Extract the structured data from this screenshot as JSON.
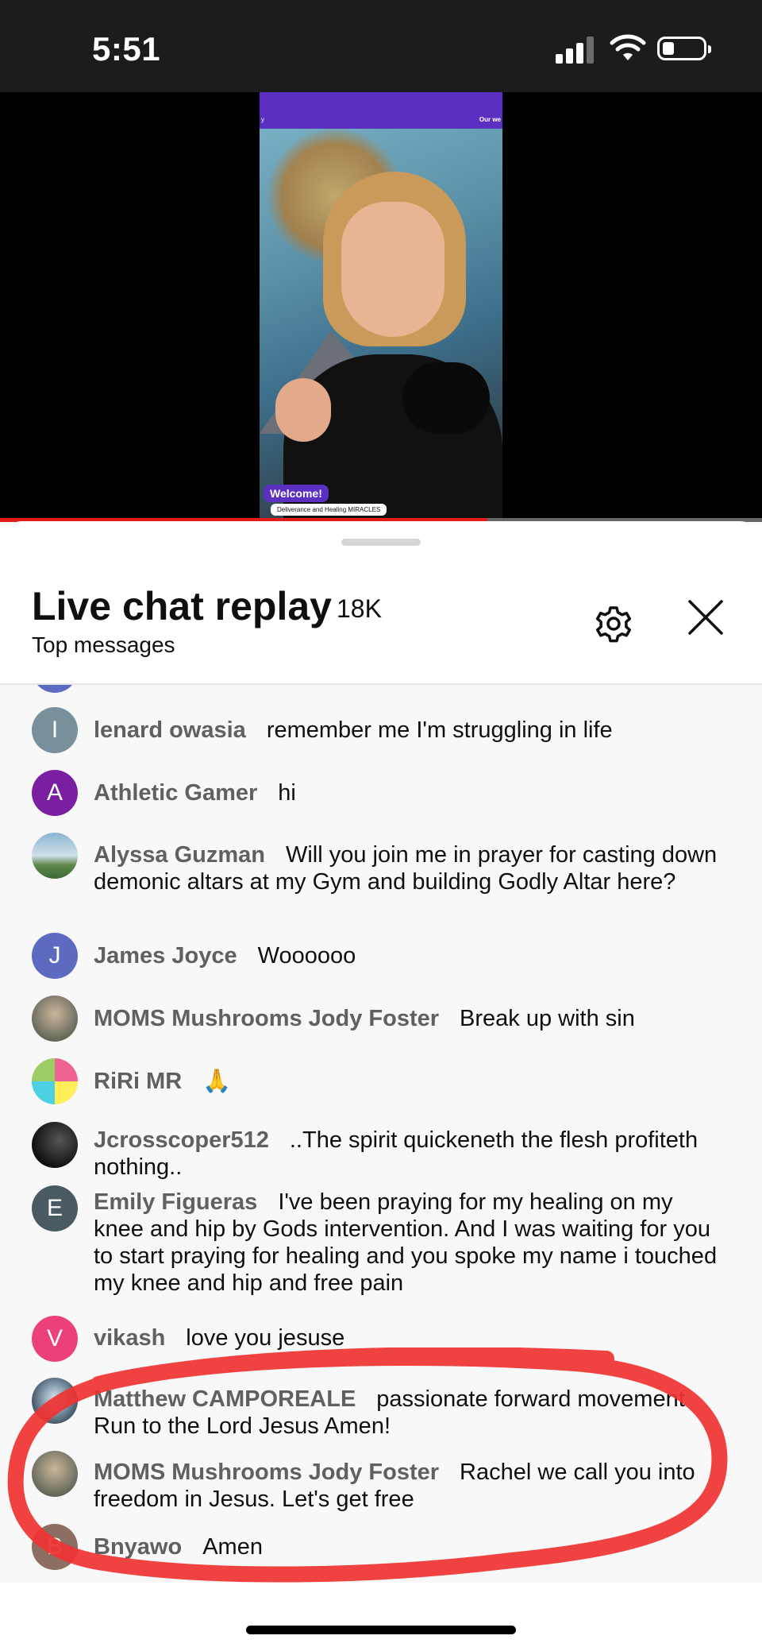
{
  "status_bar": {
    "time": "5:51"
  },
  "video": {
    "clip_top_left": "y",
    "clip_top_right": "Our we",
    "welcome": "Welcome!",
    "banner": "Deliverance and Healing MIRACLES",
    "progress_fraction": 0.64
  },
  "panel": {
    "title": "Live chat replay",
    "count": "18K",
    "subtitle": "Top messages"
  },
  "messages": [
    {
      "author": "lenard owasia",
      "text": "remember me I'm struggling in life",
      "initial": "I",
      "color": "#78909c"
    },
    {
      "author": "Athletic Gamer",
      "text": "hi",
      "initial": "A",
      "color": "#7b1fa2"
    },
    {
      "author": "Alyssa Guzman",
      "text": "Will you join me in prayer for casting down demonic altars at my Gym and building Godly Altar here?",
      "initial": "",
      "color": "#8bb3d1"
    },
    {
      "author": "James Joyce",
      "text": "Woooooo",
      "initial": "J",
      "color": "#5c6bc0"
    },
    {
      "author": "MOMS Mushrooms Jody Foster",
      "text": "Break up with sin",
      "initial": "",
      "color": "#8d8a7c"
    },
    {
      "author": "RiRi MR",
      "text": "🙏",
      "initial": "",
      "color": "#c0ca33"
    },
    {
      "author": "Jcrosscoper512",
      "text": "..The spirit quickeneth the flesh profiteth nothing..",
      "initial": "",
      "color": "#222222"
    },
    {
      "author": "Emily Figueras",
      "text": "I've been praying for my healing on my knee and hip by Gods intervention. And I was waiting for you to start praying for healing and you spoke my name i touched my knee and hip and free pain",
      "initial": "E",
      "color": "#4a5a63"
    },
    {
      "author": "vikash",
      "text": "love you jesuse",
      "initial": "V",
      "color": "#ec407a"
    },
    {
      "author": "Matthew CAMPOREALE",
      "text": "passionate forward movement Run to the Lord Jesus Amen!",
      "initial": "",
      "color": "#4f5f6f"
    },
    {
      "author": "MOMS Mushrooms Jody Foster",
      "text": "Rachel we call you into freedom in Jesus. Let's get free",
      "initial": "",
      "color": "#8d8a7c"
    },
    {
      "author": "Bnyawo",
      "text": "Amen",
      "initial": "B",
      "color": "#8d6e63"
    }
  ]
}
